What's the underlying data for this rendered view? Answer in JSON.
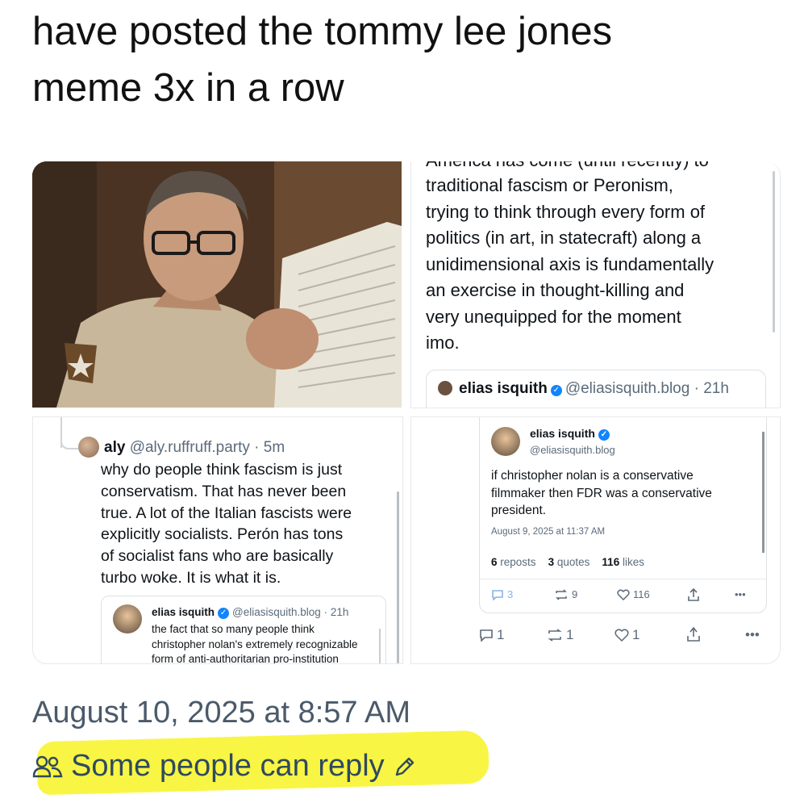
{
  "post": {
    "text": "have posted the tommy lee jones\nmeme 3x in a row",
    "timestamp": "August 10, 2025 at 8:57 AM",
    "reply_setting": "Some people can reply",
    "highlight_color": "#f9f43a"
  },
  "image_top_left": {
    "description_icon": "newspaper-photo"
  },
  "card_top_right": {
    "cut_text": "America has come (until recently) to",
    "body": "traditional fascism or Peronism,\ntrying to think through every form of\npolitics (in art, in statecraft) along a\nunidimensional axis is fundamentally\nan exercise in thought-killing and\nvery unequipped for the moment\nimo.",
    "quote_name": "elias isquith",
    "quote_handle": "@eliasisquith.blog",
    "quote_time": "· 21h"
  },
  "card_bottom_left": {
    "name": "aly",
    "handle": "@aly.ruffruff.party",
    "time": "· 5m",
    "body": "why do people think fascism is just\nconservatism. That has never been\ntrue. A lot of the Italian fascists were\nexplicitly socialists. Perón has tons\nof socialist fans who are basically\nturbo woke. It is what it is.",
    "quote_name": "elias isquith",
    "quote_handle": "@eliasisquith.blog",
    "quote_time": "· 21h",
    "quote_body": "the fact that so many people think\nchristopher nolan's extremely recognizable\nform of anti-authoritarian pro-institution"
  },
  "card_bottom_right": {
    "name": "elias isquith",
    "handle": "@eliasisquith.blog",
    "body": "if christopher nolan is a conservative\nfilmmaker then FDR was a conservative\npresident.",
    "date": "August 9, 2025 at 11:37 AM",
    "reposts_count": "6",
    "reposts_label": "reposts",
    "quotes_count": "3",
    "quotes_label": "quotes",
    "likes_count": "116",
    "likes_label": "likes",
    "inner_reply_count": "3",
    "inner_repost_count": "9",
    "inner_like_count": "116",
    "outer_reply_count": "1",
    "outer_repost_count": "1",
    "outer_like_count": "1",
    "more": "•••"
  }
}
